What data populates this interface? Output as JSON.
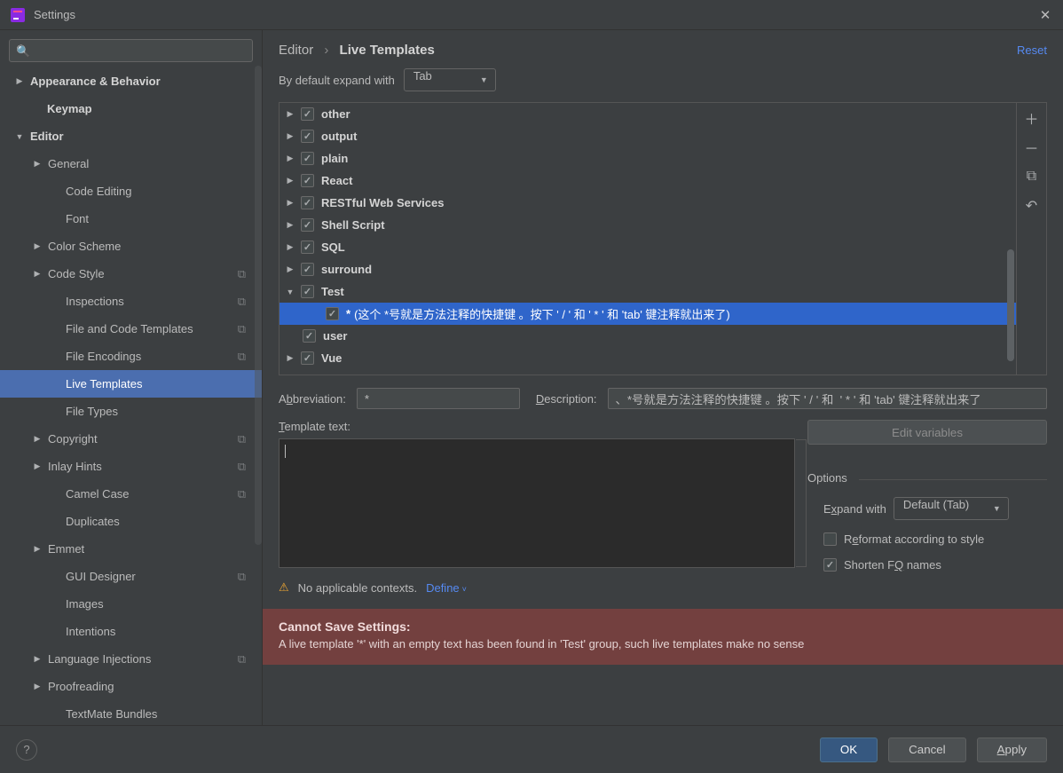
{
  "window": {
    "title": "Settings"
  },
  "sidebar": {
    "search_placeholder": "",
    "items": [
      {
        "label": "Appearance & Behavior",
        "level": 0,
        "bold": true,
        "arrow": "right"
      },
      {
        "label": "Keymap",
        "level": 0,
        "bold": true,
        "arrow": "none",
        "indent": true
      },
      {
        "label": "Editor",
        "level": 0,
        "bold": true,
        "arrow": "down"
      },
      {
        "label": "General",
        "level": 1,
        "arrow": "right"
      },
      {
        "label": "Code Editing",
        "level": 2,
        "arrow": "none"
      },
      {
        "label": "Font",
        "level": 2,
        "arrow": "none"
      },
      {
        "label": "Color Scheme",
        "level": 1,
        "arrow": "right"
      },
      {
        "label": "Code Style",
        "level": 1,
        "arrow": "right",
        "copy": true
      },
      {
        "label": "Inspections",
        "level": 2,
        "arrow": "none",
        "copy": true
      },
      {
        "label": "File and Code Templates",
        "level": 2,
        "arrow": "none",
        "copy": true
      },
      {
        "label": "File Encodings",
        "level": 2,
        "arrow": "none",
        "copy": true
      },
      {
        "label": "Live Templates",
        "level": 2,
        "arrow": "none",
        "selected": true
      },
      {
        "label": "File Types",
        "level": 2,
        "arrow": "none"
      },
      {
        "label": "Copyright",
        "level": 1,
        "arrow": "right",
        "copy": true
      },
      {
        "label": "Inlay Hints",
        "level": 1,
        "arrow": "right",
        "copy": true
      },
      {
        "label": "Camel Case",
        "level": 2,
        "arrow": "none",
        "copy": true
      },
      {
        "label": "Duplicates",
        "level": 2,
        "arrow": "none"
      },
      {
        "label": "Emmet",
        "level": 1,
        "arrow": "right"
      },
      {
        "label": "GUI Designer",
        "level": 2,
        "arrow": "none",
        "copy": true
      },
      {
        "label": "Images",
        "level": 2,
        "arrow": "none"
      },
      {
        "label": "Intentions",
        "level": 2,
        "arrow": "none"
      },
      {
        "label": "Language Injections",
        "level": 1,
        "arrow": "right",
        "copy": true
      },
      {
        "label": "Proofreading",
        "level": 1,
        "arrow": "right"
      },
      {
        "label": "TextMate Bundles",
        "level": 2,
        "arrow": "none",
        "truncated": true
      }
    ]
  },
  "breadcrumb": {
    "root": "Editor",
    "current": "Live Templates"
  },
  "reset": "Reset",
  "expand": {
    "label": "By default expand with",
    "value": "Tab"
  },
  "tree": {
    "items": [
      {
        "label": "other",
        "arrow": "right",
        "checked": true
      },
      {
        "label": "output",
        "arrow": "right",
        "checked": true
      },
      {
        "label": "plain",
        "arrow": "right",
        "checked": true
      },
      {
        "label": "React",
        "arrow": "right",
        "checked": true
      },
      {
        "label": "RESTful Web Services",
        "arrow": "right",
        "checked": true
      },
      {
        "label": "Shell Script",
        "arrow": "right",
        "checked": true
      },
      {
        "label": "SQL",
        "arrow": "right",
        "checked": true
      },
      {
        "label": "surround",
        "arrow": "right",
        "checked": true
      },
      {
        "label": "Test",
        "arrow": "down",
        "checked": true
      },
      {
        "label": "*",
        "desc": "(这个 *号就是方法注释的快捷键 。按下 ' / ' 和  ' * ' 和 'tab' 键注释就出来了)",
        "child": true,
        "checked": true,
        "selected": true
      },
      {
        "label": "user",
        "arrow": "none",
        "checked": true,
        "childsimple": true
      },
      {
        "label": "Vue",
        "arrow": "right",
        "checked": true
      }
    ]
  },
  "form": {
    "abbr_label": "Abbreviation:",
    "abbr_value": "*",
    "desc_label": "Description:",
    "desc_value": "、*号就是方法注释的快捷键 。按下 ' / ' 和  ' * ' 和 'tab' 键注释就出来了",
    "template_label": "Template text:",
    "edit_vars": "Edit variables",
    "options_label": "Options",
    "expand_with_label": "Expand with",
    "expand_with_value": "Default (Tab)",
    "reformat_label": "Reformat according to style",
    "shorten_label": "Shorten FQ names",
    "context_warning": "No applicable contexts.",
    "define": "Define"
  },
  "error": {
    "title": "Cannot Save Settings",
    "body": "A live template '*' with an empty text has been found in 'Test' group, such live templates make no sense"
  },
  "buttons": {
    "ok": "OK",
    "cancel": "Cancel",
    "apply": "Apply"
  }
}
